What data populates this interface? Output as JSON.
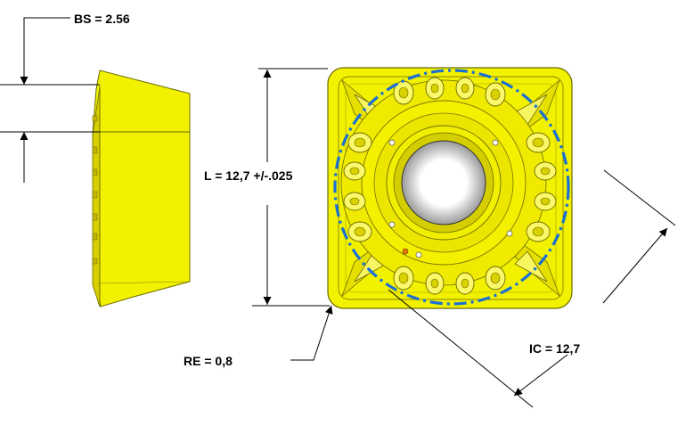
{
  "dimensions": {
    "bs": "BS = 2.56",
    "length": "L = 12,7 +/-.025",
    "corner_radius": "RE = 0,8",
    "inscribed_circle": "IC = 12,7"
  },
  "colors": {
    "insert_yellow": "#f2f200",
    "insert_shadow": "#c9c200",
    "edge_dark": "#6b6b00",
    "ic_circle": "#1a6fd6",
    "dimension_line": "#000000",
    "background": "#ffffff"
  }
}
